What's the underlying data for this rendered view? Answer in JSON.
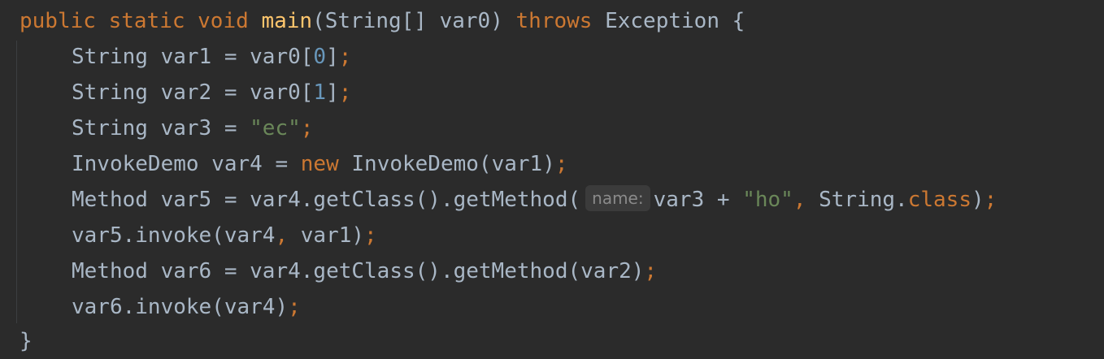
{
  "code": {
    "line0": {
      "kw1": "public",
      "kw2": "static",
      "kw3": "void",
      "method": "main",
      "sig": "(String[] var0) ",
      "kw4": "throws",
      "rest": " Exception {"
    },
    "line1": {
      "a": "String var1 = var0[",
      "num": "0",
      "b": "]",
      "semi": ";"
    },
    "line2": {
      "a": "String var2 = var0[",
      "num": "1",
      "b": "]",
      "semi": ";"
    },
    "line3": {
      "a": "String var3 = ",
      "str": "\"ec\"",
      "semi": ";"
    },
    "line4": {
      "a": "InvokeDemo var4 = ",
      "kw": "new",
      "b": " InvokeDemo(var1)",
      "semi": ";"
    },
    "line5": {
      "a": "Method var5 = var4.getClass().getMethod(",
      "hint": "name:",
      "b": "var3 + ",
      "str": "\"ho\"",
      "comma": ",",
      "c": " String.",
      "kw": "class",
      "d": ")",
      "semi": ";"
    },
    "line6": {
      "a": "var5.invoke(var4",
      "comma": ",",
      "b": " var1)",
      "semi": ";"
    },
    "line7": {
      "a": "Method var6 = var4.getClass().getMethod(var2)",
      "semi": ";"
    },
    "line8": {
      "a": "var6.invoke(var4)",
      "semi": ";"
    },
    "line9": {
      "a": "}"
    }
  },
  "colors": {
    "background": "#2b2b2b",
    "default_text": "#a9b7c6",
    "keyword": "#cc7832",
    "method_name": "#ffc66d",
    "number": "#6897bb",
    "string": "#6a8759",
    "inlay_hint_text": "#8a8a8a",
    "inlay_hint_bg": "#3b3b3b"
  }
}
